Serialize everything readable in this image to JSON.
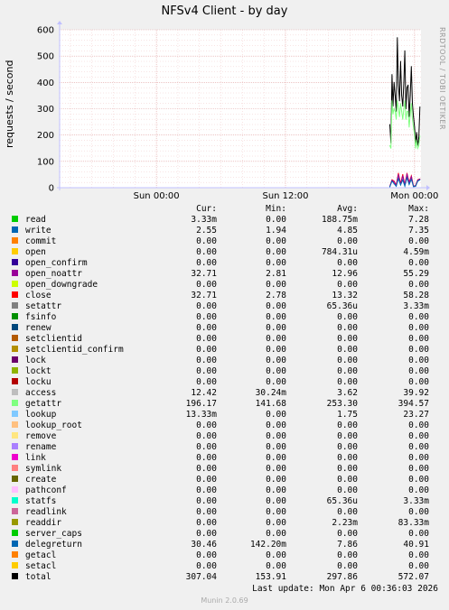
{
  "title": "NFSv4 Client - by day",
  "side_note": "RRDTOOL / TOBI OETIKER",
  "ylabel": "requests / second",
  "columns": [
    "Cur:",
    "Min:",
    "Avg:",
    "Max:"
  ],
  "last_update": "Last update: Mon Apr  6 00:36:03 2026",
  "footer": "Munin 2.0.69",
  "legend": [
    {
      "name": "read",
      "color": "#00cc00",
      "cur": "3.33m",
      "min": "0.00",
      "avg": "188.75m",
      "max": "7.28"
    },
    {
      "name": "write",
      "color": "#0066b3",
      "cur": "2.55",
      "min": "1.94",
      "avg": "4.85",
      "max": "7.35"
    },
    {
      "name": "commit",
      "color": "#ff8000",
      "cur": "0.00",
      "min": "0.00",
      "avg": "0.00",
      "max": "0.00"
    },
    {
      "name": "open",
      "color": "#ffcc00",
      "cur": "0.00",
      "min": "0.00",
      "avg": "784.31u",
      "max": "4.59m"
    },
    {
      "name": "open_confirm",
      "color": "#330099",
      "cur": "0.00",
      "min": "0.00",
      "avg": "0.00",
      "max": "0.00"
    },
    {
      "name": "open_noattr",
      "color": "#990099",
      "cur": "32.71",
      "min": "2.81",
      "avg": "12.96",
      "max": "55.29"
    },
    {
      "name": "open_downgrade",
      "color": "#ccff00",
      "cur": "0.00",
      "min": "0.00",
      "avg": "0.00",
      "max": "0.00"
    },
    {
      "name": "close",
      "color": "#ff0000",
      "cur": "32.71",
      "min": "2.78",
      "avg": "13.32",
      "max": "58.28"
    },
    {
      "name": "setattr",
      "color": "#808080",
      "cur": "0.00",
      "min": "0.00",
      "avg": "65.36u",
      "max": "3.33m"
    },
    {
      "name": "fsinfo",
      "color": "#008f00",
      "cur": "0.00",
      "min": "0.00",
      "avg": "0.00",
      "max": "0.00"
    },
    {
      "name": "renew",
      "color": "#00487d",
      "cur": "0.00",
      "min": "0.00",
      "avg": "0.00",
      "max": "0.00"
    },
    {
      "name": "setclientid",
      "color": "#b35a00",
      "cur": "0.00",
      "min": "0.00",
      "avg": "0.00",
      "max": "0.00"
    },
    {
      "name": "setclientid_confirm",
      "color": "#b38f00",
      "cur": "0.00",
      "min": "0.00",
      "avg": "0.00",
      "max": "0.00"
    },
    {
      "name": "lock",
      "color": "#6b006b",
      "cur": "0.00",
      "min": "0.00",
      "avg": "0.00",
      "max": "0.00"
    },
    {
      "name": "lockt",
      "color": "#8fb300",
      "cur": "0.00",
      "min": "0.00",
      "avg": "0.00",
      "max": "0.00"
    },
    {
      "name": "locku",
      "color": "#b30000",
      "cur": "0.00",
      "min": "0.00",
      "avg": "0.00",
      "max": "0.00"
    },
    {
      "name": "access",
      "color": "#bebebe",
      "cur": "12.42",
      "min": "30.24m",
      "avg": "3.62",
      "max": "39.92"
    },
    {
      "name": "getattr",
      "color": "#80ff80",
      "cur": "196.17",
      "min": "141.68",
      "avg": "253.30",
      "max": "394.57"
    },
    {
      "name": "lookup",
      "color": "#80c9ff",
      "cur": "13.33m",
      "min": "0.00",
      "avg": "1.75",
      "max": "23.27"
    },
    {
      "name": "lookup_root",
      "color": "#ffc080",
      "cur": "0.00",
      "min": "0.00",
      "avg": "0.00",
      "max": "0.00"
    },
    {
      "name": "remove",
      "color": "#ffe680",
      "cur": "0.00",
      "min": "0.00",
      "avg": "0.00",
      "max": "0.00"
    },
    {
      "name": "rename",
      "color": "#aa80ff",
      "cur": "0.00",
      "min": "0.00",
      "avg": "0.00",
      "max": "0.00"
    },
    {
      "name": "link",
      "color": "#ee00cc",
      "cur": "0.00",
      "min": "0.00",
      "avg": "0.00",
      "max": "0.00"
    },
    {
      "name": "symlink",
      "color": "#ff8080",
      "cur": "0.00",
      "min": "0.00",
      "avg": "0.00",
      "max": "0.00"
    },
    {
      "name": "create",
      "color": "#666600",
      "cur": "0.00",
      "min": "0.00",
      "avg": "0.00",
      "max": "0.00"
    },
    {
      "name": "pathconf",
      "color": "#ffbfff",
      "cur": "0.00",
      "min": "0.00",
      "avg": "0.00",
      "max": "0.00"
    },
    {
      "name": "statfs",
      "color": "#00ffcc",
      "cur": "0.00",
      "min": "0.00",
      "avg": "65.36u",
      "max": "3.33m"
    },
    {
      "name": "readlink",
      "color": "#cc6699",
      "cur": "0.00",
      "min": "0.00",
      "avg": "0.00",
      "max": "0.00"
    },
    {
      "name": "readdir",
      "color": "#999900",
      "cur": "0.00",
      "min": "0.00",
      "avg": "2.23m",
      "max": "83.33m"
    },
    {
      "name": "server_caps",
      "color": "#00cc00",
      "cur": "0.00",
      "min": "0.00",
      "avg": "0.00",
      "max": "0.00"
    },
    {
      "name": "delegreturn",
      "color": "#0066b3",
      "cur": "30.46",
      "min": "142.20m",
      "avg": "7.86",
      "max": "40.91"
    },
    {
      "name": "getacl",
      "color": "#ff8000",
      "cur": "0.00",
      "min": "0.00",
      "avg": "0.00",
      "max": "0.00"
    },
    {
      "name": "setacl",
      "color": "#ffcc00",
      "cur": "0.00",
      "min": "0.00",
      "avg": "0.00",
      "max": "0.00"
    },
    {
      "name": "total",
      "color": "#000000",
      "cur": "307.04",
      "min": "153.91",
      "avg": "297.86",
      "max": "572.07"
    }
  ],
  "chart_data": {
    "type": "line",
    "title": "NFSv4 Client - by day",
    "ylabel": "requests / second",
    "xlabel": "",
    "ylim": [
      0,
      600
    ],
    "yticks": [
      0,
      100,
      200,
      300,
      400,
      500,
      600
    ],
    "xticks": [
      "Sun 00:00",
      "Sun 12:00",
      "Mon 00:00"
    ],
    "x_range_hours": [
      -33,
      0.6
    ],
    "grid": true,
    "series": [
      {
        "name": "total",
        "color": "#000000",
        "x": [
          -2.3,
          -2.2,
          -2.1,
          -2.0,
          -1.9,
          -1.8,
          -1.7,
          -1.6,
          -1.5,
          -1.4,
          -1.3,
          -1.2,
          -1.1,
          -1.0,
          -0.9,
          -0.8,
          -0.7,
          -0.6,
          -0.5,
          -0.4,
          -0.3,
          -0.2,
          -0.1,
          0.0,
          0.1,
          0.2,
          0.3,
          0.4,
          0.5
        ],
        "values": [
          240,
          170,
          430,
          310,
          400,
          350,
          290,
          570,
          390,
          330,
          480,
          350,
          310,
          400,
          520,
          300,
          380,
          390,
          270,
          350,
          460,
          320,
          270,
          230,
          170,
          210,
          160,
          190,
          307
        ]
      },
      {
        "name": "getattr",
        "color": "#80ff80",
        "x": [
          -2.3,
          -2.2,
          -2.1,
          -2.0,
          -1.9,
          -1.8,
          -1.7,
          -1.6,
          -1.5,
          -1.4,
          -1.3,
          -1.2,
          -1.1,
          -1.0,
          -0.9,
          -0.8,
          -0.7,
          -0.6,
          -0.5,
          -0.4,
          -0.3,
          -0.2,
          -0.1,
          0.0,
          0.1,
          0.2,
          0.3,
          0.4,
          0.5
        ],
        "values": [
          160,
          150,
          330,
          280,
          300,
          290,
          260,
          330,
          300,
          270,
          320,
          290,
          260,
          300,
          330,
          260,
          290,
          290,
          230,
          280,
          320,
          260,
          230,
          200,
          150,
          180,
          150,
          160,
          196
        ]
      },
      {
        "name": "close",
        "color": "#ff0000",
        "x": [
          -2.3,
          -2.1,
          -1.9,
          -1.7,
          -1.5,
          -1.3,
          -1.1,
          -0.9,
          -0.7,
          -0.5,
          -0.3,
          -0.1,
          0.1,
          0.3,
          0.5
        ],
        "values": [
          5,
          30,
          25,
          10,
          55,
          15,
          50,
          10,
          55,
          20,
          45,
          5,
          8,
          30,
          33
        ]
      },
      {
        "name": "open_noattr",
        "color": "#990099",
        "x": [
          -2.3,
          -2.1,
          -1.9,
          -1.7,
          -1.5,
          -1.3,
          -1.1,
          -0.9,
          -0.7,
          -0.5,
          -0.3,
          -0.1,
          0.1,
          0.3,
          0.5
        ],
        "values": [
          5,
          28,
          22,
          8,
          50,
          12,
          45,
          9,
          52,
          18,
          42,
          5,
          7,
          28,
          33
        ]
      },
      {
        "name": "delegreturn",
        "color": "#0066b3",
        "x": [
          -2.3,
          -2.1,
          -1.9,
          -1.7,
          -1.5,
          -1.3,
          -1.1,
          -0.9,
          -0.7,
          -0.5,
          -0.3,
          -0.1,
          0.1,
          0.3,
          0.5
        ],
        "values": [
          3,
          25,
          15,
          5,
          35,
          10,
          30,
          6,
          38,
          12,
          32,
          4,
          5,
          25,
          30
        ]
      }
    ]
  }
}
